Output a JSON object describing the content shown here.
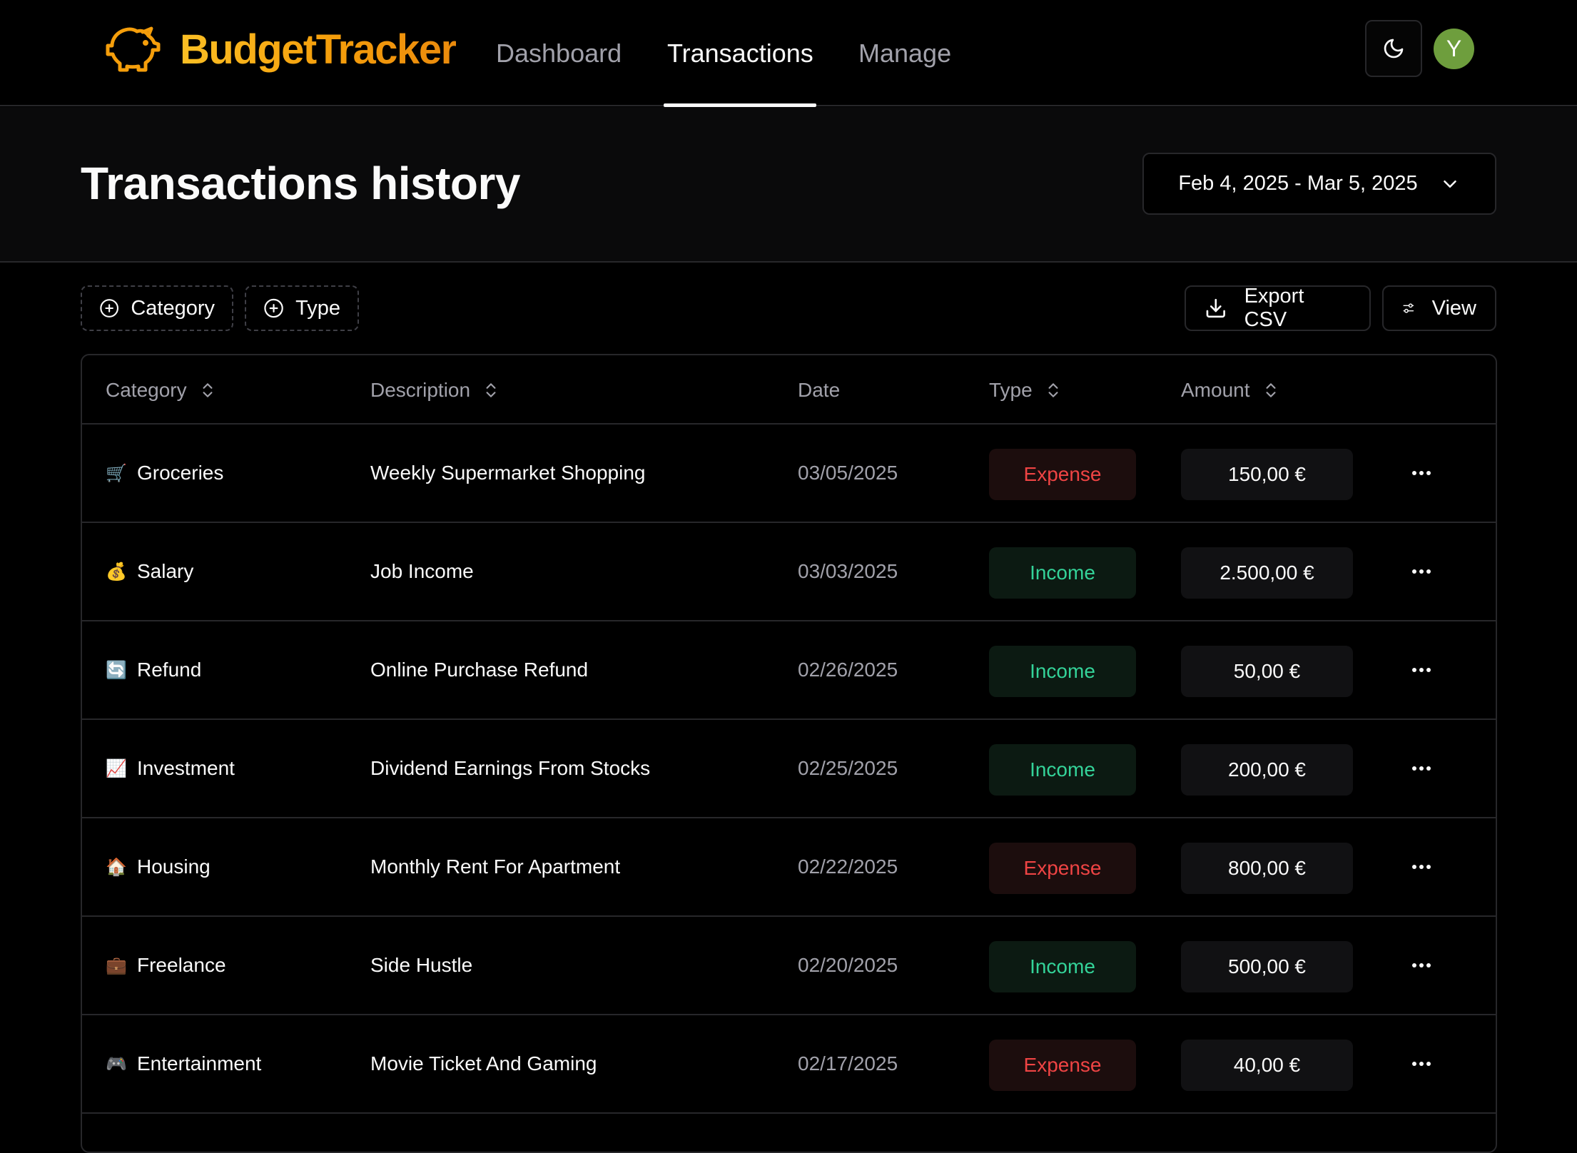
{
  "app": {
    "name": "BudgetTracker",
    "avatar_initial": "Y"
  },
  "nav": {
    "links": [
      {
        "label": "Dashboard",
        "active": false
      },
      {
        "label": "Transactions",
        "active": true
      },
      {
        "label": "Manage",
        "active": false
      }
    ]
  },
  "header": {
    "title": "Transactions history",
    "date_range": "Feb 4, 2025 - Mar 5, 2025"
  },
  "toolbar": {
    "filter_category": "Category",
    "filter_type": "Type",
    "export_label": "Export CSV",
    "view_label": "View"
  },
  "table": {
    "columns": {
      "category": "Category",
      "description": "Description",
      "date": "Date",
      "type": "Type",
      "amount": "Amount"
    },
    "rows": [
      {
        "icon": "🛒",
        "category": "Groceries",
        "description": "Weekly Supermarket Shopping",
        "date": "03/05/2025",
        "type": "Expense",
        "amount": "150,00 €"
      },
      {
        "icon": "💰",
        "category": "Salary",
        "description": "Job Income",
        "date": "03/03/2025",
        "type": "Income",
        "amount": "2.500,00 €"
      },
      {
        "icon": "🔄",
        "category": "Refund",
        "description": "Online Purchase Refund",
        "date": "02/26/2025",
        "type": "Income",
        "amount": "50,00 €"
      },
      {
        "icon": "📈",
        "category": "Investment",
        "description": "Dividend Earnings From Stocks",
        "date": "02/25/2025",
        "type": "Income",
        "amount": "200,00 €"
      },
      {
        "icon": "🏠",
        "category": "Housing",
        "description": "Monthly Rent For Apartment",
        "date": "02/22/2025",
        "type": "Expense",
        "amount": "800,00 €"
      },
      {
        "icon": "💼",
        "category": "Freelance",
        "description": "Side Hustle",
        "date": "02/20/2025",
        "type": "Income",
        "amount": "500,00 €"
      },
      {
        "icon": "🎮",
        "category": "Entertainment",
        "description": "Movie Ticket And Gaming",
        "date": "02/17/2025",
        "type": "Expense",
        "amount": "40,00 €"
      }
    ]
  },
  "colors": {
    "brand": "#f59e0b",
    "expense": "#ef4444",
    "income": "#34d399",
    "avatar": "#6e9e3d"
  }
}
